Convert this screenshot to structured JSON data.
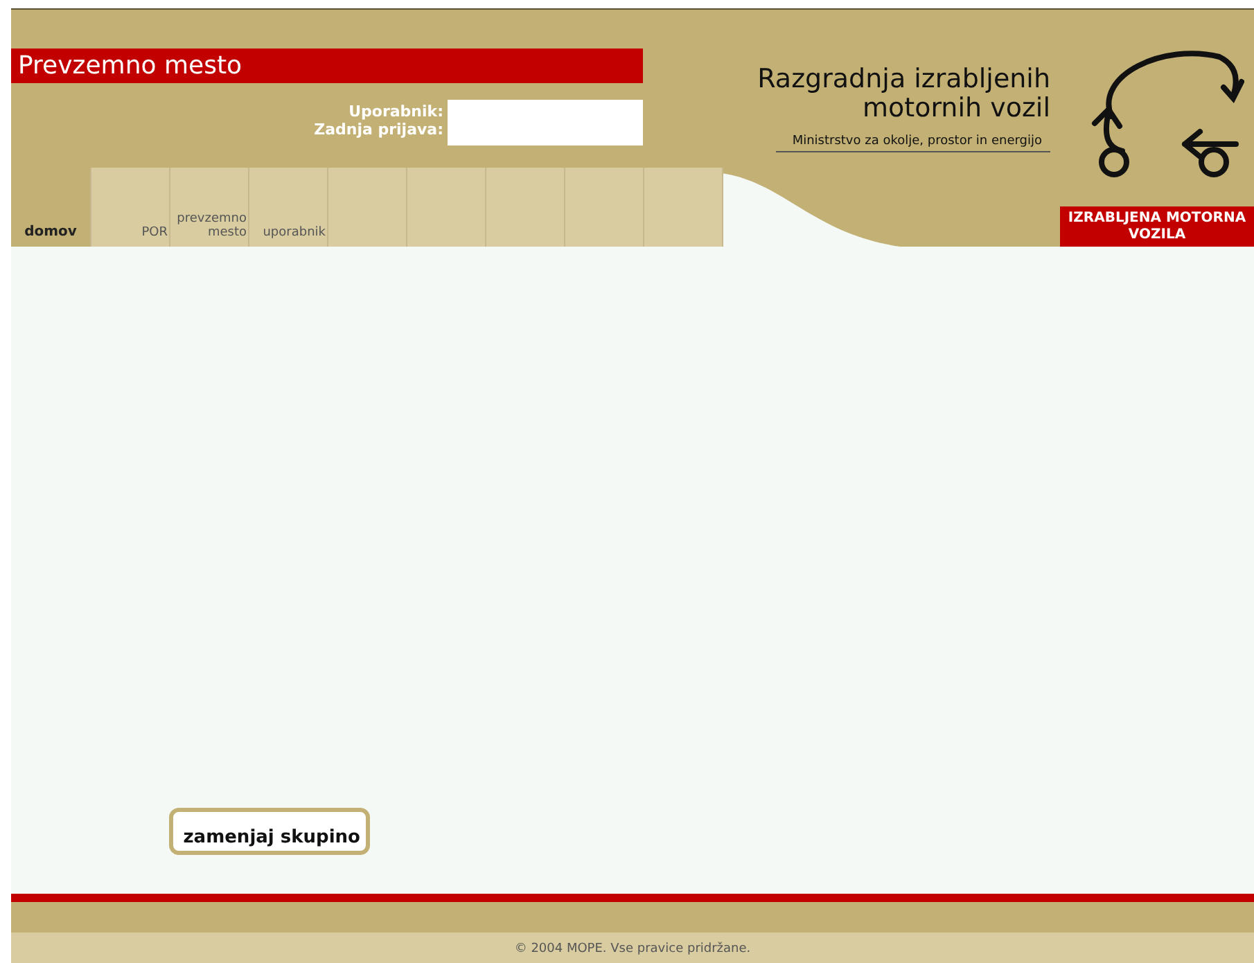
{
  "page_title": "Prevzemno mesto",
  "user_info": {
    "labels": [
      "Uporabnik:",
      "Zadnja prijava:"
    ]
  },
  "nav": [
    {
      "label": "domov",
      "selected": true
    },
    {
      "label": "POR",
      "selected": false
    },
    {
      "label": "prevzemno mesto",
      "selected": false
    },
    {
      "label": "uporabnik",
      "selected": false
    }
  ],
  "logo": {
    "title": "Razgradnja izrabljenih motornih vozil",
    "subtitle": "Ministrstvo za okolje, prostor in energijo",
    "badge": "IZRABLJENA MOTORNA VOZILA"
  },
  "buttons": [
    "zamenjaj skupino"
  ],
  "footer": "© 2004 MOPE. Vse pravice pridržane."
}
